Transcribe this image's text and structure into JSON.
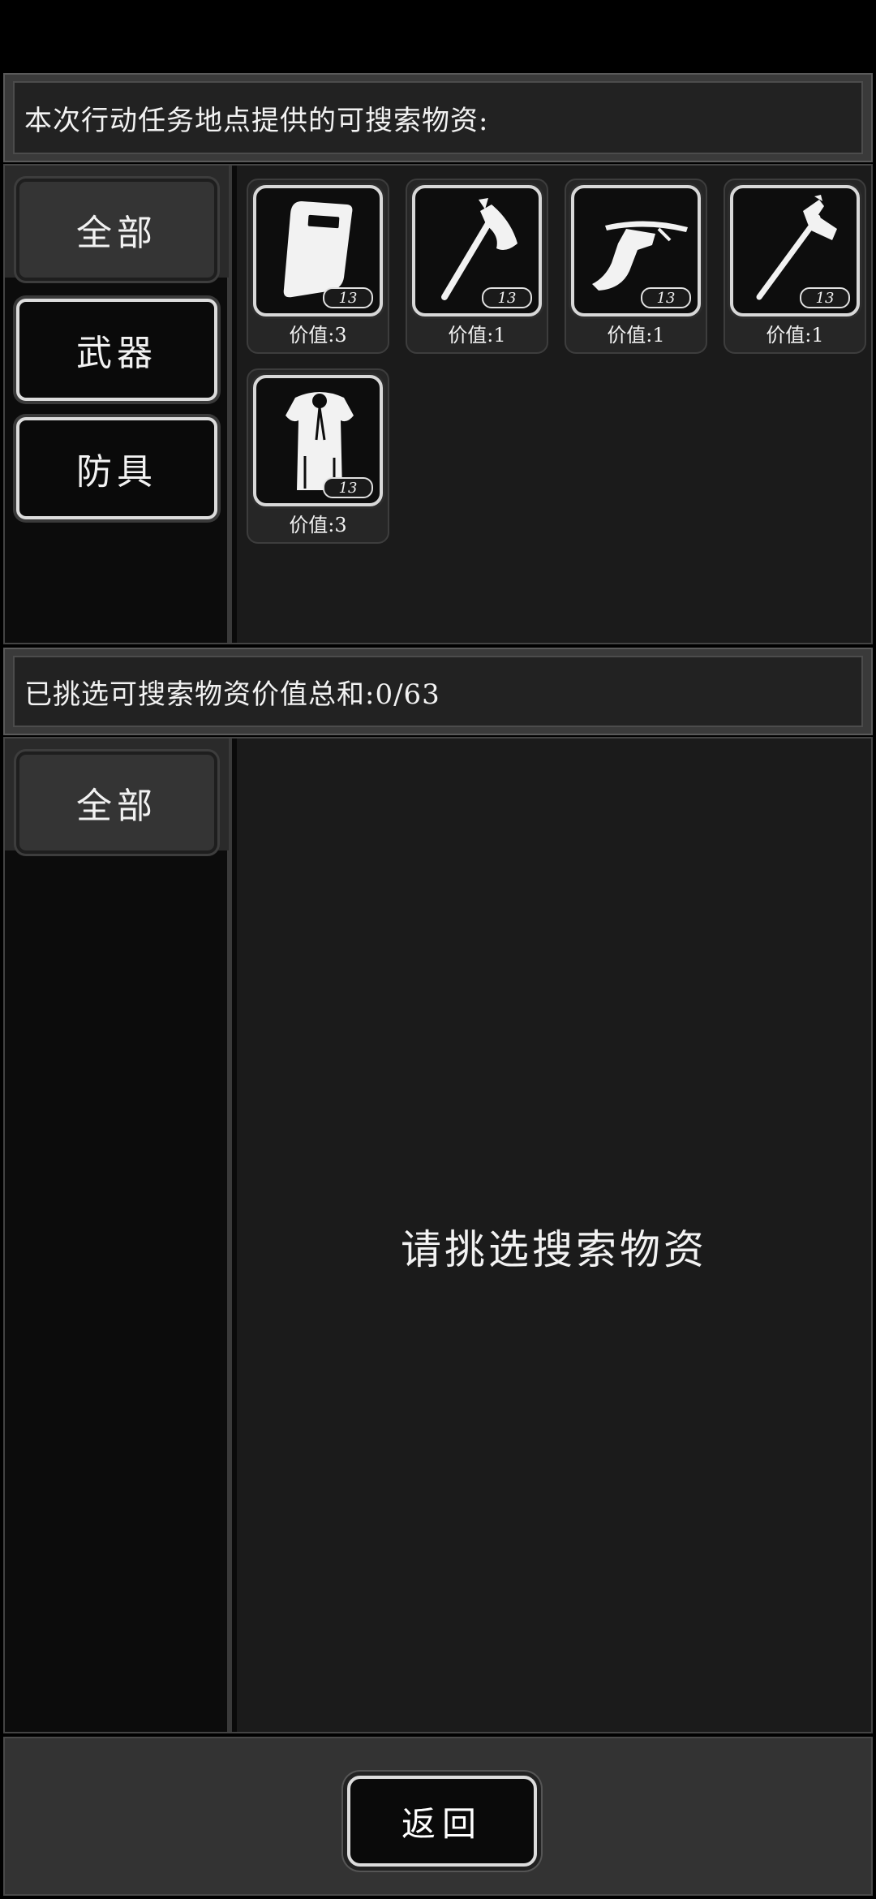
{
  "available": {
    "header": "本次行动任务地点提供的可搜索物资:",
    "tabs": [
      {
        "label": "全部",
        "active": true
      },
      {
        "label": "武器",
        "active": false
      },
      {
        "label": "防具",
        "active": false
      }
    ],
    "items": [
      {
        "icon": "riot-shield-icon",
        "count": "13",
        "value_label": "价值:3"
      },
      {
        "icon": "axe-icon",
        "count": "13",
        "value_label": "价值:1"
      },
      {
        "icon": "crossbow-icon",
        "count": "13",
        "value_label": "价值:1"
      },
      {
        "icon": "war-hammer-icon",
        "count": "13",
        "value_label": "价值:1"
      },
      {
        "icon": "fur-cloak-icon",
        "count": "13",
        "value_label": "价值:3"
      }
    ]
  },
  "selected": {
    "header": "已挑选可搜索物资价值总和:0/63",
    "tabs": [
      {
        "label": "全部",
        "active": true
      }
    ],
    "empty_hint": "请挑选搜索物资"
  },
  "footer": {
    "back_label": "返回"
  },
  "colors": {
    "background": "#000000",
    "panel": "#1b1b1b",
    "text": "#f2f2f2",
    "frame": "#d8d8d8"
  }
}
